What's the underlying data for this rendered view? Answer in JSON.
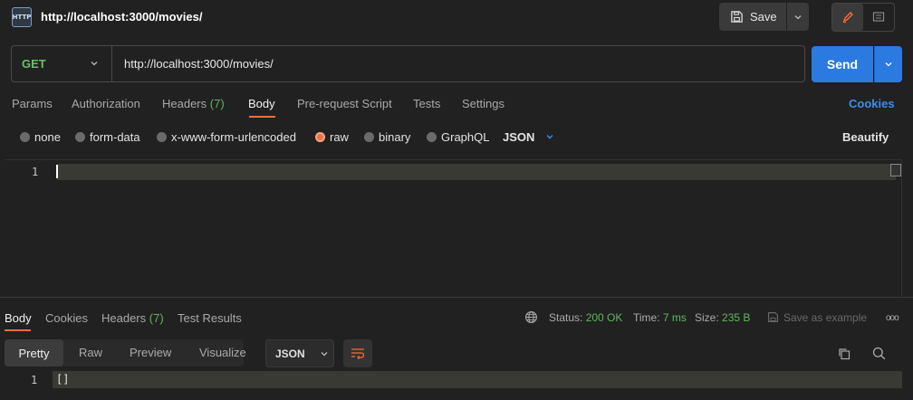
{
  "header": {
    "icon_label": "HTTP",
    "title": "http://localhost:3000/movies/",
    "save_label": "Save"
  },
  "request": {
    "method": "GET",
    "url": "http://localhost:3000/movies/",
    "send_label": "Send"
  },
  "request_tabs": {
    "params": "Params",
    "authorization": "Authorization",
    "headers": "Headers",
    "headers_count": "(7)",
    "body": "Body",
    "prerequest": "Pre-request Script",
    "tests": "Tests",
    "settings": "Settings",
    "cookies": "Cookies"
  },
  "body_modes": {
    "none": "none",
    "form_data": "form-data",
    "urlencoded": "x-www-form-urlencoded",
    "raw": "raw",
    "binary": "binary",
    "graphql": "GraphQL",
    "language": "JSON",
    "beautify": "Beautify"
  },
  "editor": {
    "line_number": "1"
  },
  "response_tabs": {
    "body": "Body",
    "cookies": "Cookies",
    "headers": "Headers",
    "headers_count": "(7)",
    "test_results": "Test Results"
  },
  "response_status": {
    "status_label": "Status:",
    "status_value": "200 OK",
    "time_label": "Time:",
    "time_value": "7 ms",
    "size_label": "Size:",
    "size_value": "235 B",
    "save_example": "Save as example",
    "more": "ooo"
  },
  "response_format": {
    "pretty": "Pretty",
    "raw": "Raw",
    "preview": "Preview",
    "visualize": "Visualize",
    "language": "JSON"
  },
  "response_body": {
    "line_number": "1",
    "content": "[]"
  },
  "colors": {
    "accent": "#ff6c37",
    "send": "#2a7ae2",
    "success": "#5cb85c"
  }
}
